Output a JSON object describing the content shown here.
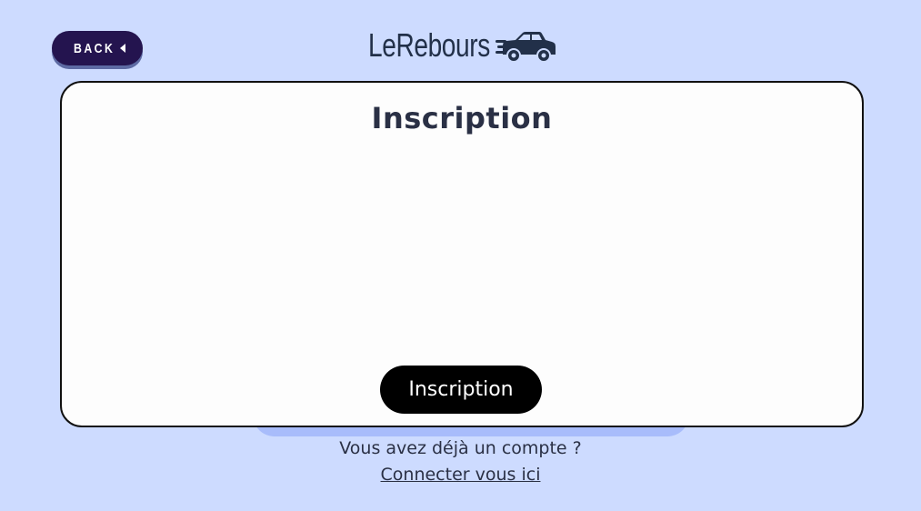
{
  "header": {
    "back_label": "BACK",
    "back_icon": "caret-left-icon",
    "logo_text": "LeRebours",
    "logo_icon": "car-icon"
  },
  "card": {
    "title": "Inscription",
    "submit_label": "Inscription"
  },
  "footer": {
    "question": "Vous avez déjà un compte ?",
    "login_link": "Connecter vous ici"
  },
  "colors": {
    "background": "#cddbff",
    "card_background": "#fdfdfd",
    "back_button": "#24144f",
    "submit_button": "#000000",
    "text": "#2a3045",
    "accent_strip": "#a8bcfb"
  }
}
